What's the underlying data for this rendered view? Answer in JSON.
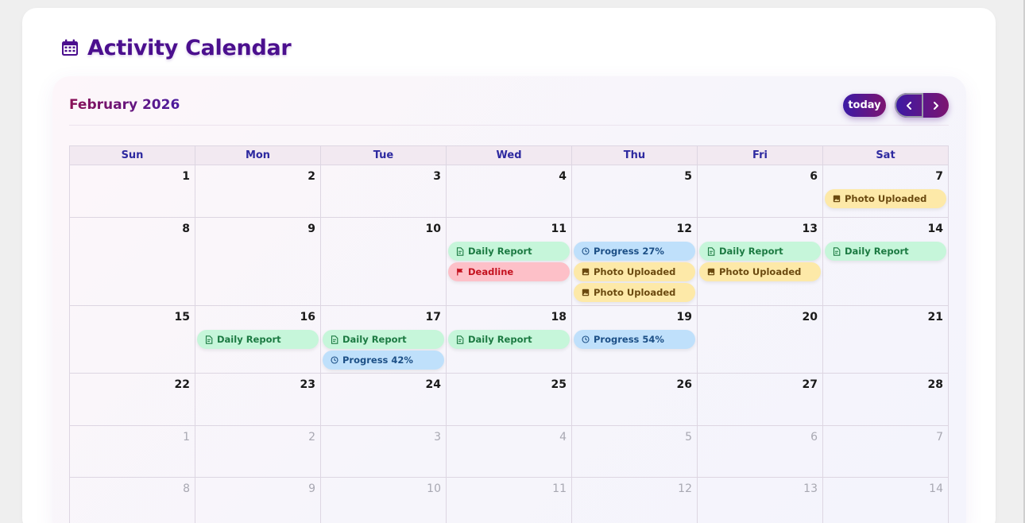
{
  "page": {
    "title": "Activity Calendar"
  },
  "toolbar": {
    "month": "February 2026",
    "today_label": "today",
    "prev_label": "‹",
    "next_label": "›"
  },
  "colors": {
    "report": "#c6f6da",
    "photo": "#fde9a8",
    "progress": "#bfe0fb",
    "deadline": "#fdc0c8",
    "accent": "#4b0f8e"
  },
  "days_of_week": [
    "Sun",
    "Mon",
    "Tue",
    "Wed",
    "Thu",
    "Fri",
    "Sat"
  ],
  "weeks": [
    {
      "days": [
        {
          "n": "1",
          "events": []
        },
        {
          "n": "2",
          "events": []
        },
        {
          "n": "3",
          "events": []
        },
        {
          "n": "4",
          "events": []
        },
        {
          "n": "5",
          "events": []
        },
        {
          "n": "6",
          "events": []
        },
        {
          "n": "7",
          "events": [
            {
              "type": "photo",
              "icon": "image-icon",
              "label": "Photo Uploaded"
            }
          ]
        }
      ]
    },
    {
      "days": [
        {
          "n": "8",
          "events": []
        },
        {
          "n": "9",
          "events": []
        },
        {
          "n": "10",
          "events": []
        },
        {
          "n": "11",
          "events": [
            {
              "type": "report",
              "icon": "document-icon",
              "label": "Daily Report"
            },
            {
              "type": "deadline",
              "icon": "flag-icon",
              "label": "Deadline"
            }
          ]
        },
        {
          "n": "12",
          "events": [
            {
              "type": "progress",
              "icon": "clock-icon",
              "label": "Progress 27%"
            },
            {
              "type": "photo",
              "icon": "image-icon",
              "label": "Photo Uploaded"
            },
            {
              "type": "photo",
              "icon": "image-icon",
              "label": "Photo Uploaded"
            }
          ]
        },
        {
          "n": "13",
          "events": [
            {
              "type": "report",
              "icon": "document-icon",
              "label": "Daily Report"
            },
            {
              "type": "photo",
              "icon": "image-icon",
              "label": "Photo Uploaded"
            }
          ]
        },
        {
          "n": "14",
          "events": [
            {
              "type": "report",
              "icon": "document-icon",
              "label": "Daily Report"
            }
          ]
        }
      ]
    },
    {
      "days": [
        {
          "n": "15",
          "events": []
        },
        {
          "n": "16",
          "events": [
            {
              "type": "report",
              "icon": "document-icon",
              "label": "Daily Report"
            }
          ]
        },
        {
          "n": "17",
          "events": [
            {
              "type": "report",
              "icon": "document-icon",
              "label": "Daily Report"
            },
            {
              "type": "progress",
              "icon": "clock-icon",
              "label": "Progress 42%"
            }
          ]
        },
        {
          "n": "18",
          "events": [
            {
              "type": "report",
              "icon": "document-icon",
              "label": "Daily Report"
            }
          ]
        },
        {
          "n": "19",
          "events": [
            {
              "type": "progress",
              "icon": "clock-icon",
              "label": "Progress 54%"
            }
          ]
        },
        {
          "n": "20",
          "events": []
        },
        {
          "n": "21",
          "events": []
        }
      ]
    },
    {
      "days": [
        {
          "n": "22",
          "events": []
        },
        {
          "n": "23",
          "events": []
        },
        {
          "n": "24",
          "events": []
        },
        {
          "n": "25",
          "events": []
        },
        {
          "n": "26",
          "events": []
        },
        {
          "n": "27",
          "events": []
        },
        {
          "n": "28",
          "events": []
        }
      ]
    },
    {
      "days": [
        {
          "n": "1",
          "other": true,
          "events": []
        },
        {
          "n": "2",
          "other": true,
          "events": []
        },
        {
          "n": "3",
          "other": true,
          "events": []
        },
        {
          "n": "4",
          "other": true,
          "events": []
        },
        {
          "n": "5",
          "other": true,
          "events": []
        },
        {
          "n": "6",
          "other": true,
          "events": []
        },
        {
          "n": "7",
          "other": true,
          "events": []
        }
      ]
    },
    {
      "days": [
        {
          "n": "8",
          "other": true,
          "events": []
        },
        {
          "n": "9",
          "other": true,
          "events": []
        },
        {
          "n": "10",
          "other": true,
          "events": []
        },
        {
          "n": "11",
          "other": true,
          "events": []
        },
        {
          "n": "12",
          "other": true,
          "events": []
        },
        {
          "n": "13",
          "other": true,
          "events": []
        },
        {
          "n": "14",
          "other": true,
          "events": []
        }
      ]
    }
  ]
}
